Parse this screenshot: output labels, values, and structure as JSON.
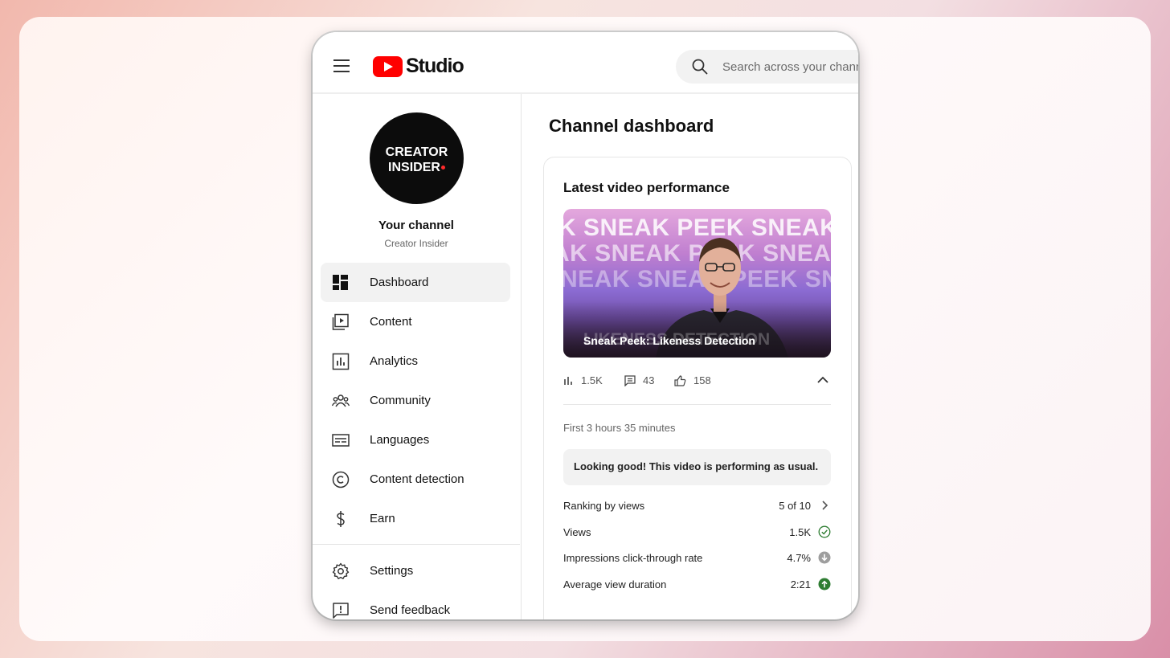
{
  "header": {
    "logo_text": "Studio",
    "search_placeholder": "Search across your channel"
  },
  "channel": {
    "avatar_line1": "CREATOR",
    "avatar_line2": "INSIDER",
    "title": "Your channel",
    "name": "Creator Insider"
  },
  "sidebar": {
    "items": [
      {
        "label": "Dashboard",
        "icon": "dashboard-icon"
      },
      {
        "label": "Content",
        "icon": "content-icon"
      },
      {
        "label": "Analytics",
        "icon": "analytics-icon"
      },
      {
        "label": "Community",
        "icon": "community-icon"
      },
      {
        "label": "Languages",
        "icon": "languages-icon"
      },
      {
        "label": "Content detection",
        "icon": "copyright-icon"
      },
      {
        "label": "Earn",
        "icon": "dollar-icon"
      },
      {
        "label": "Settings",
        "icon": "gear-icon"
      },
      {
        "label": "Send feedback",
        "icon": "feedback-icon"
      }
    ]
  },
  "main": {
    "page_title": "Channel dashboard",
    "card": {
      "title": "Latest video performance",
      "thumbnail_text": "SNEAK PEEK",
      "thumbnail_bottom_text": "LIKENESS DETECTION",
      "video_title": "Sneak Peek: Likeness Detection",
      "views": "1.5K",
      "comments": "43",
      "likes": "158",
      "period": "First 3 hours 35 minutes",
      "notice": "Looking good! This video is performing as usual.",
      "metrics": [
        {
          "label": "Ranking by views",
          "value": "5 of 10",
          "status": "chevron-right-icon"
        },
        {
          "label": "Views",
          "value": "1.5K",
          "status": "check-circle-icon"
        },
        {
          "label": "Impressions click-through rate",
          "value": "4.7%",
          "status": "arrow-down-circle-icon"
        },
        {
          "label": "Average view duration",
          "value": "2:21",
          "status": "arrow-up-circle-icon"
        }
      ]
    }
  },
  "colors": {
    "brand_red": "#ff0000",
    "positive_green": "#2e7d32",
    "neutral_gray": "#9e9e9e"
  }
}
